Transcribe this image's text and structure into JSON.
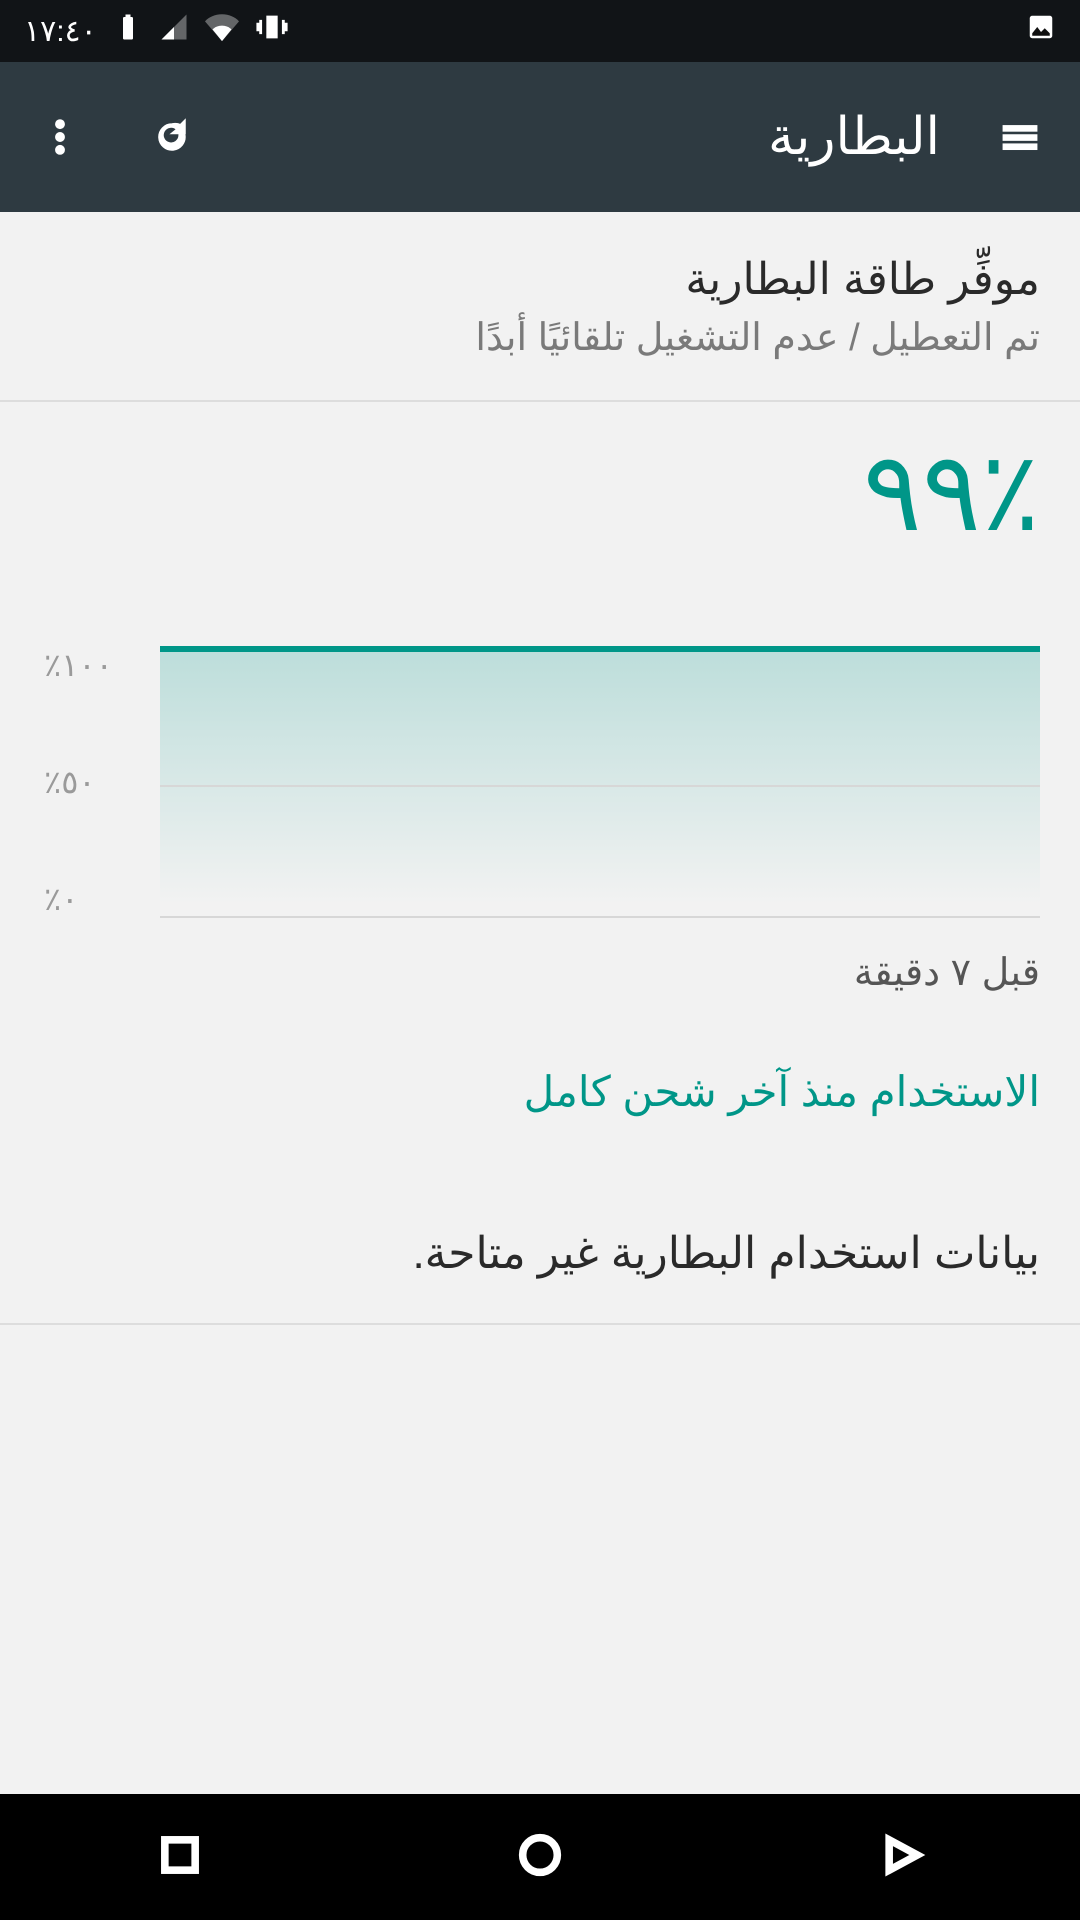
{
  "status": {
    "time": "١٧:٤٠"
  },
  "appbar": {
    "title": "البطارية"
  },
  "battery_saver": {
    "title": "موفِّر طاقة البطارية",
    "subtitle": "تم التعطيل / عدم التشغيل تلقائيًا أبدًا"
  },
  "battery": {
    "percent_display": "٪٩٩",
    "since_last_charge": "قبل ٧ دقيقة",
    "usage_since_header": "الاستخدام منذ آخر شحن كامل",
    "usage_unavailable": "بيانات استخدام البطارية غير متاحة."
  },
  "chart_data": {
    "type": "area",
    "title": "",
    "xlabel": "",
    "ylabel": "",
    "ylim": [
      0,
      100
    ],
    "y_ticks_display": [
      "٪١٠٠",
      "٪٥٠",
      "٪٠"
    ],
    "x_span_minutes": 7,
    "x": [
      0,
      7
    ],
    "values": [
      99,
      99
    ]
  }
}
